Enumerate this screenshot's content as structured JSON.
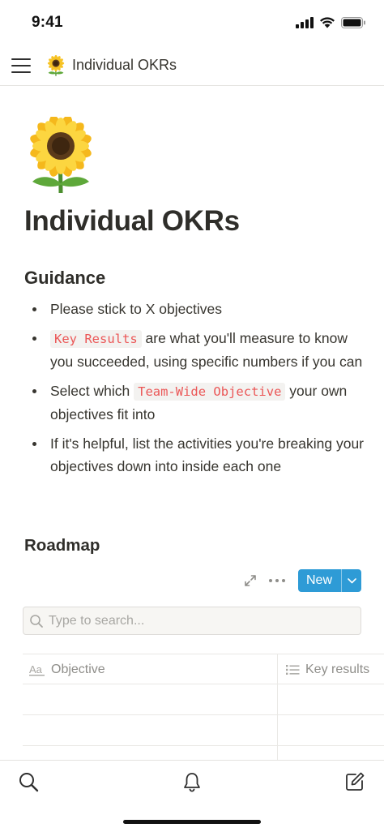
{
  "status_bar": {
    "time": "9:41",
    "icons": [
      "signal-icon",
      "wifi-icon",
      "battery-icon"
    ]
  },
  "nav": {
    "menu_icon": "hamburger-menu-icon",
    "page_emoji": "sunflower-icon",
    "title": "Individual OKRs"
  },
  "page": {
    "icon": "sunflower-icon",
    "title": "Individual OKRs",
    "guidance": {
      "heading": "Guidance",
      "bullets": [
        {
          "text": "Please stick to X objectives"
        },
        {
          "code": "Key Results",
          "text": " are what you'll measure to know you succeeded, using specific numbers if you can"
        },
        {
          "prefix": "Select which ",
          "code": "Team-Wide Objective",
          "text": " your own objectives fit into"
        },
        {
          "text": "If it's helpful, list the activities you're breaking your objectives down into inside each one"
        }
      ]
    },
    "roadmap": {
      "heading": "Roadmap",
      "toolbar": {
        "expand_icon": "expand-icon",
        "more_icon": "more-icon",
        "new_label": "New",
        "new_caret_icon": "chevron-down-icon"
      },
      "search": {
        "placeholder": "Type to search...",
        "value": ""
      },
      "table": {
        "columns": [
          {
            "icon": "text-property-icon",
            "label": "Objective"
          },
          {
            "icon": "list-property-icon",
            "label": "Key results"
          }
        ],
        "rows": [
          [
            "",
            ""
          ],
          [
            "",
            ""
          ],
          [
            "",
            ""
          ]
        ]
      }
    }
  },
  "bottom_bar": {
    "tabs": [
      "search-icon",
      "bell-icon",
      "compose-icon"
    ]
  },
  "colors": {
    "accent": "#2e9bd6",
    "code_text": "#eb5757",
    "code_bg": "#f3f2f0",
    "text": "#37352f",
    "muted": "#8f8e8a"
  }
}
